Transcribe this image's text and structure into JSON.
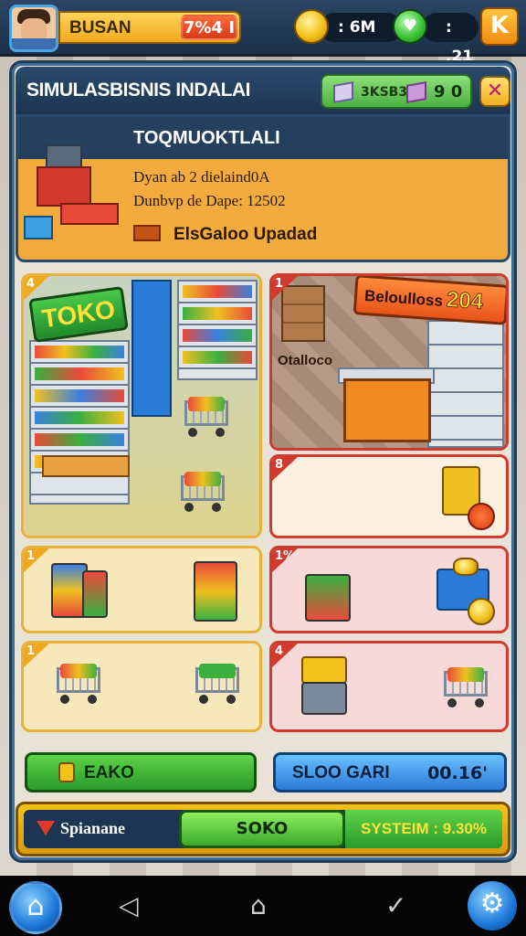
{
  "player": {
    "name": "BUSAN",
    "level": "7%4 I"
  },
  "currency": {
    "coins": ": 6M",
    "gems": ": ,21",
    "gem_symbol": "♥"
  },
  "menu_button": "K",
  "panel": {
    "title": "SIMULASBISNIS INDALAI",
    "cash_label": "3KSB3",
    "cash_value": "9 0"
  },
  "info": {
    "title": "TOQMUOKTLALI",
    "line1": "Dyan ab 2 dielaind0A",
    "line2": "Dunbvp de Dape: 12502",
    "status": "ElsGaloo Upadad"
  },
  "cards": {
    "store": {
      "badge": "4",
      "sign": "TOKO"
    },
    "shop": {
      "badge": "1",
      "sign": "Beloulloss",
      "sign_number": "204",
      "label": "Otalloco"
    },
    "c3": {
      "badge": "8"
    },
    "c4": {
      "badge": "1"
    },
    "c5": {
      "badge": "1%"
    },
    "c6": {
      "badge": "1"
    },
    "c7": {
      "badge": "4"
    }
  },
  "buttons": {
    "green_label": "EAKO",
    "blue_label": "SLOO GARI",
    "blue_value": "00.16'"
  },
  "status_bar": {
    "label": "Spianane",
    "button": "SOKO",
    "system": "SYSTEIM : 9.30%"
  },
  "nav": {
    "back": "◁",
    "home": "⌂",
    "check": "✓"
  },
  "colors": {
    "accent": "#f2ab3d",
    "header": "#1c3552",
    "green": "#3aa82a",
    "blue": "#2a7ad8",
    "red": "#d23a2e"
  }
}
